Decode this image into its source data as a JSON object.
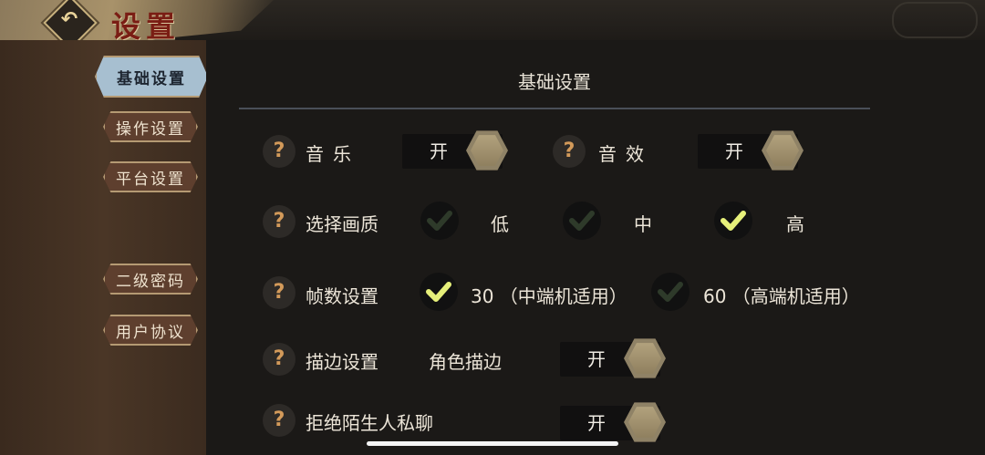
{
  "header": {
    "title": "设置",
    "back_icon": "back-arrow-icon"
  },
  "sidebar": {
    "items": [
      {
        "label": "基础设置",
        "active": true
      },
      {
        "label": "操作设置",
        "active": false
      },
      {
        "label": "平台设置",
        "active": false
      },
      {
        "label": "二级密码",
        "active": false
      },
      {
        "label": "用户协议",
        "active": false
      }
    ]
  },
  "main": {
    "section_title": "基础设置",
    "help_glyph": "?",
    "music": {
      "label": "音乐",
      "toggle": "开"
    },
    "sfx": {
      "label": "音效",
      "toggle": "开"
    },
    "quality": {
      "label": "选择画质",
      "options": [
        {
          "label": "低",
          "selected": false
        },
        {
          "label": "中",
          "selected": false
        },
        {
          "label": "高",
          "selected": true
        }
      ]
    },
    "fps": {
      "label": "帧数设置",
      "options": [
        {
          "label": "30 （中端机适用）",
          "selected": true
        },
        {
          "label": "60 （高端机适用）",
          "selected": false
        }
      ]
    },
    "outline": {
      "label": "描边设置",
      "sub_label": "角色描边",
      "toggle": "开"
    },
    "reject_strangers": {
      "label": "拒绝陌生人私聊",
      "toggle": "开"
    }
  },
  "colors": {
    "check_active": "#e6f07a",
    "check_inactive": "#2e3a2a",
    "active_tab": "#a7bfd0"
  }
}
